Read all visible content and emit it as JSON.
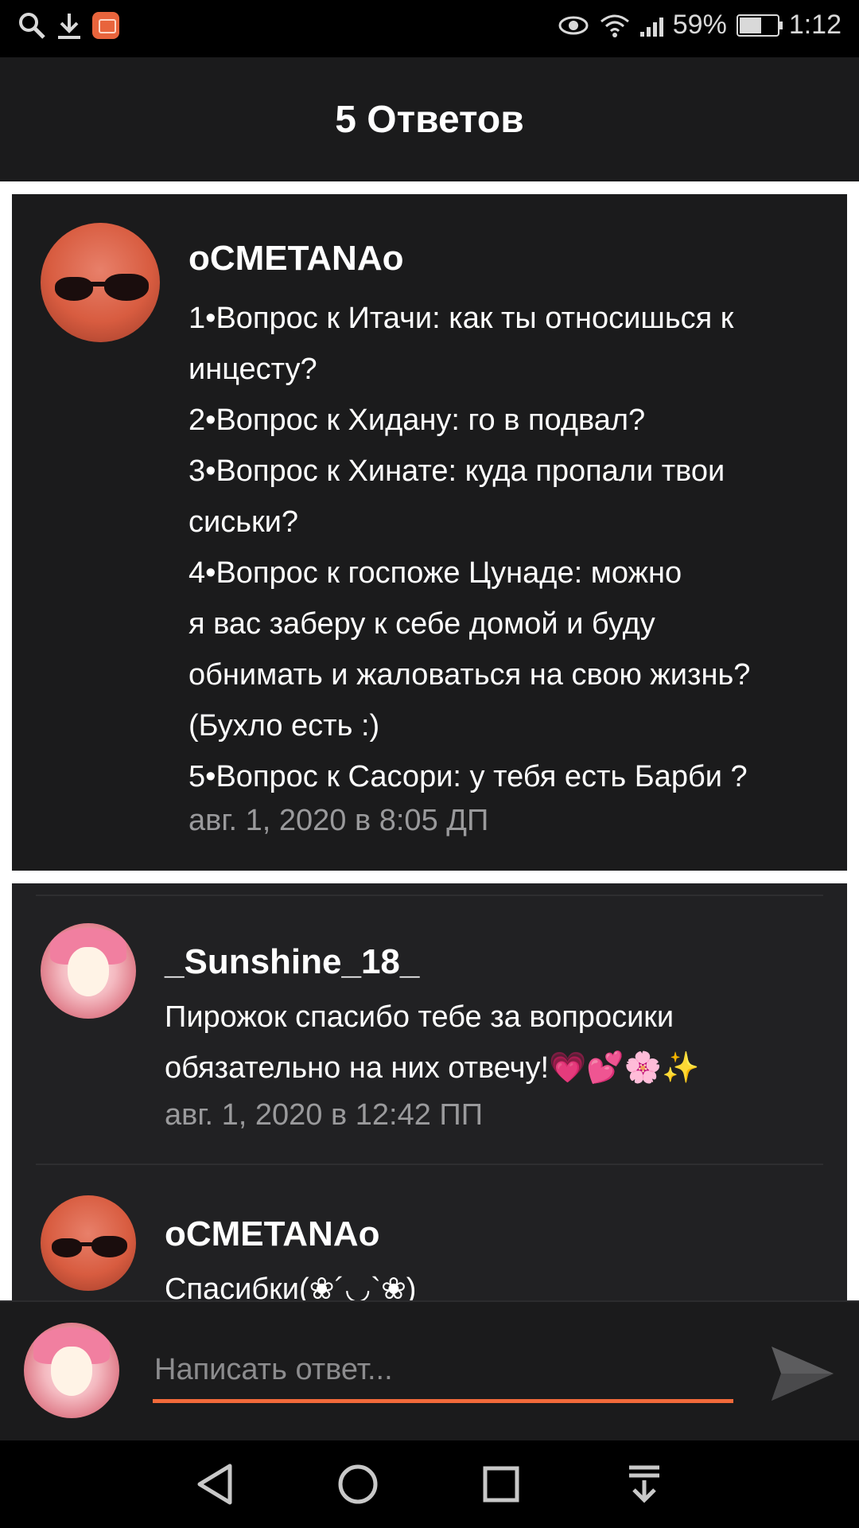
{
  "status_bar": {
    "battery_percent": "59%",
    "battery_level": 0.59,
    "time": "1:12",
    "icons": [
      "search-icon",
      "download-icon",
      "app-notification-icon",
      "eye-icon",
      "wifi-icon",
      "signal-icon",
      "battery-icon"
    ]
  },
  "header": {
    "title": "5 Ответов"
  },
  "main_comment": {
    "author": "oCMETANAo",
    "body": "1•Вопрос к Итачи: как ты относишься к\nинцесту?\n2•Вопрос к Хидану: го в подвал?\n3•Вопрос к Хинате: куда пропали твои\nсиськи?\n4•Вопрос к госпоже Цунаде: можно\nя вас заберу к себе домой и буду\nобнимать и жаловаться на свою жизнь?\n(Бухло есть :)\n5•Вопрос к Сасори: у тебя есть Барби ?",
    "timestamp": "авг. 1, 2020 в 8:05 ДП"
  },
  "replies": [
    {
      "author": "_Sunshine_18_",
      "body": "Пирожок спасибо тебе за вопросики\nобязательно на них отвечу!💗💕🌸✨",
      "timestamp": "авг. 1, 2020 в 12:42 ПП"
    },
    {
      "author": "oCMETANAo",
      "body": "Спасибки(❀´◡`❀)",
      "timestamp": ""
    }
  ],
  "compose": {
    "placeholder": "Написать ответ..."
  },
  "colors": {
    "accent": "#f26a3a",
    "background_dark": "#1b1b1c",
    "reply_background": "#212123",
    "muted_text": "#9a9a9c"
  }
}
